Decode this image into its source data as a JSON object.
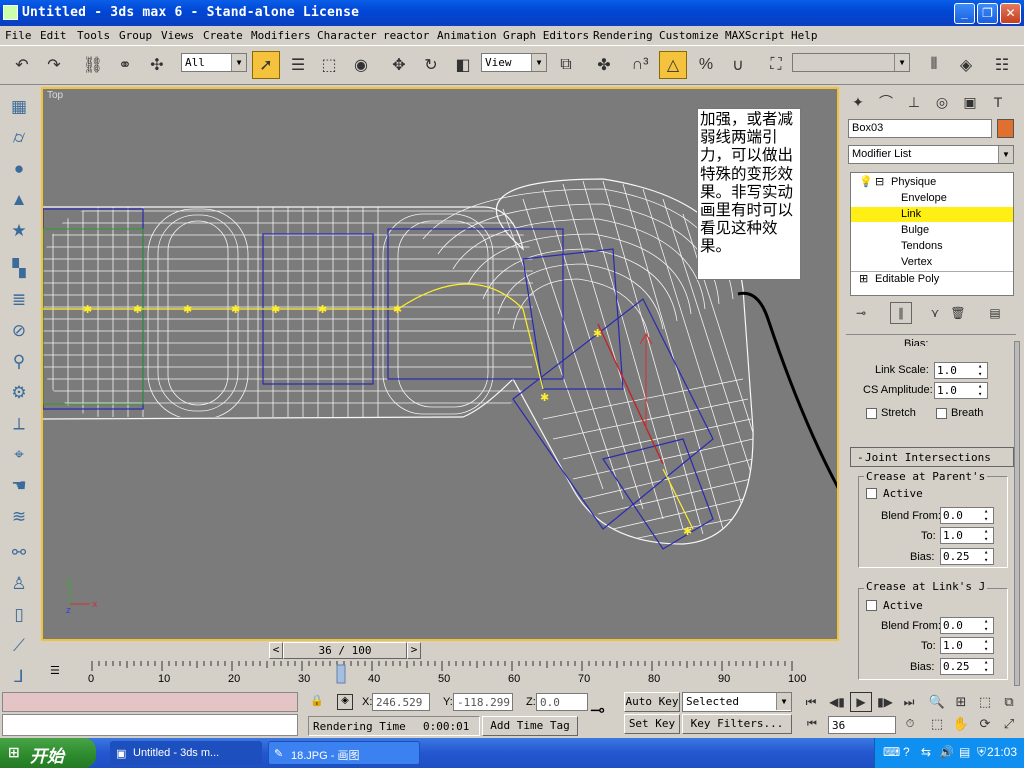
{
  "window": {
    "title": "Untitled - 3ds max 6 - Stand-alone License"
  },
  "menu": [
    "File",
    "Edit",
    "Tools",
    "Group",
    "Views",
    "Create",
    "Modifiers",
    "Character",
    "reactor",
    "Animation",
    "Graph Editors",
    "Rendering",
    "Customize",
    "MAXScript",
    "Help"
  ],
  "toolbar": {
    "selection_filter": "All",
    "ref_coord": "View"
  },
  "viewport": {
    "label": "Top",
    "annotation": "加强，或者减弱线两端引力，可以做出特殊的变形效果。非写实动画里有时可以看见这种效果。",
    "axis_x": "x",
    "axis_y": "y",
    "axis_z": "z"
  },
  "command_panel": {
    "object_name": "Box03",
    "object_color": "#e07030",
    "modifier_list": "Modifier List",
    "stack": [
      {
        "label": "Physique",
        "level": 0,
        "expander": "⊟"
      },
      {
        "label": "Envelope",
        "level": 1
      },
      {
        "label": "Link",
        "level": 1,
        "selected": true
      },
      {
        "label": "Bulge",
        "level": 1
      },
      {
        "label": "Tendons",
        "level": 1
      },
      {
        "label": "Vertex",
        "level": 1
      },
      {
        "label": "Editable Poly",
        "level": 0,
        "expander": "⊞"
      }
    ],
    "params": {
      "bias_label": "Bias:",
      "link_scale_label": "Link Scale:",
      "link_scale": "1.0",
      "cs_amplitude_label": "CS Amplitude:",
      "cs_amplitude": "1.0",
      "stretch_label": "Stretch",
      "breath_label": "Breath"
    },
    "joint_rollout": "Joint Intersections",
    "crease_parent": {
      "title": "Crease at Parent's",
      "active": "Active",
      "blend_from_label": "Blend From:",
      "blend_from": "0.0",
      "to_label": "To:",
      "to": "1.0",
      "bias_label": "Bias:",
      "bias": "0.25"
    },
    "crease_link": {
      "title": "Crease at Link's J",
      "active": "Active",
      "blend_from_label": "Blend From:",
      "blend_from": "0.0",
      "to_label": "To:",
      "to": "1.0",
      "bias_label": "Bias:",
      "bias": "0.25"
    }
  },
  "timeline": {
    "frame": "36 / 100",
    "ticks": [
      "0",
      "10",
      "20",
      "30",
      "40",
      "50",
      "60",
      "70",
      "80",
      "90",
      "100"
    ]
  },
  "status": {
    "x_label": "X:",
    "x": "246.529",
    "y_label": "Y:",
    "y": "-118.299",
    "z_label": "Z:",
    "z": "0.0",
    "auto_key": "Auto Key",
    "selected": "Selected",
    "set_key": "Set Key",
    "key_filters": "Key Filters...",
    "rendering_time_label": "Rendering Time",
    "rendering_time": "0:00:01",
    "add_time_tag": "Add Time Tag",
    "current_frame": "36"
  },
  "taskbar": {
    "start": "开始",
    "items": [
      "Untitled - 3ds m...",
      "18.JPG - 画图"
    ],
    "clock": "21:03"
  }
}
